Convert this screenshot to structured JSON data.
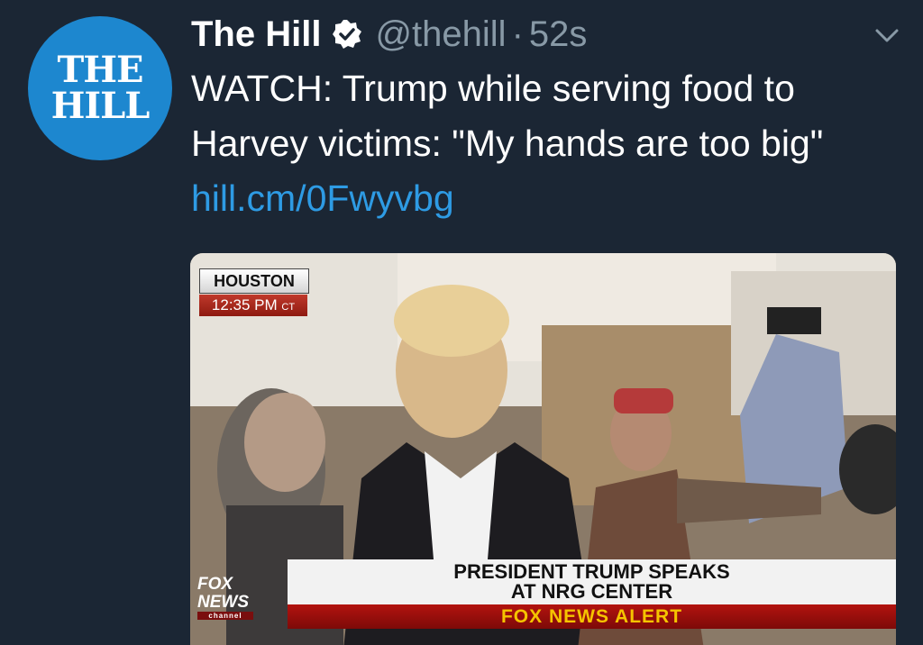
{
  "tweet": {
    "avatar_line1": "THE",
    "avatar_line2": "HILL",
    "display_name": "The Hill",
    "handle": "@thehill",
    "separator": "·",
    "time": "52s",
    "text": "WATCH: Trump while serving food to Harvey victims: \"My hands are too big\" ",
    "link": "hill.cm/0Fwyvbg",
    "icons": {
      "verified": "verified-badge-icon",
      "menu": "chevron-down-icon"
    },
    "colors": {
      "background": "#1b2634",
      "avatar": "#1d87cf",
      "link": "#2e9be4",
      "muted": "#8899a6"
    }
  },
  "media": {
    "location": "HOUSTON",
    "clock": "12:35 PM",
    "timezone": "CT",
    "network_line1": "FOX",
    "network_line2": "NEWS",
    "network_line3": "channel",
    "headline_line1": "PRESIDENT TRUMP SPEAKS",
    "headline_line2": "AT NRG CENTER",
    "alert": "FOX NEWS ALERT"
  }
}
